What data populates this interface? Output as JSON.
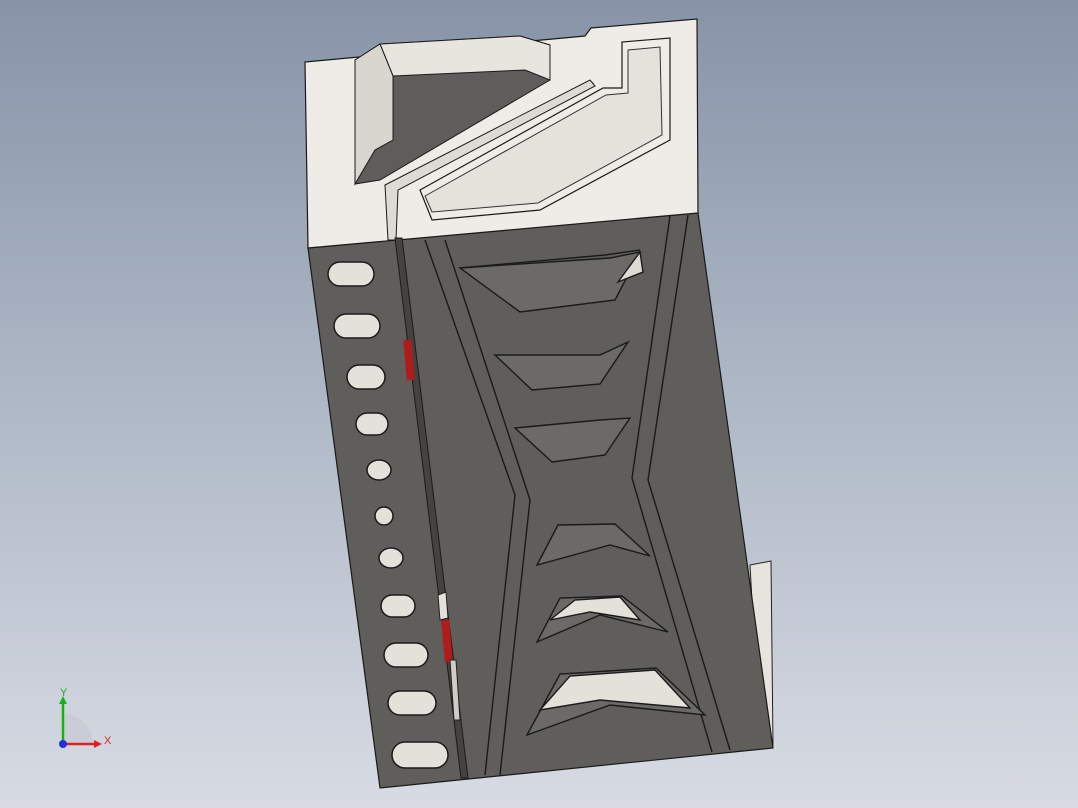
{
  "triad": {
    "x_label": "X",
    "y_label": "Y",
    "x_color": "#e02020",
    "y_color": "#18b018",
    "z_color": "#2030e0"
  },
  "colors": {
    "background_top": "#8794a8",
    "background_bottom": "#d8dbe3",
    "model_light_face": "#eeeae5",
    "model_dark_face": "#5e5d59",
    "model_edge": "#1a1a1a",
    "highlight_red": "#b01c1c"
  }
}
